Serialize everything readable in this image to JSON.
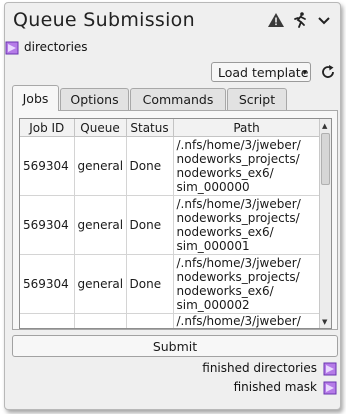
{
  "node": {
    "title": "Queue Submission",
    "header_icons": [
      "warning-icon",
      "running-person-icon",
      "chevron-down-icon"
    ],
    "input_port_label": "directories",
    "load_template_label": "Load template",
    "tabs": [
      {
        "label": "Jobs",
        "active": true
      },
      {
        "label": "Options",
        "active": false
      },
      {
        "label": "Commands",
        "active": false
      },
      {
        "label": "Script",
        "active": false
      }
    ],
    "table": {
      "columns": [
        "Job ID",
        "Queue",
        "Status",
        "Path"
      ],
      "rows": [
        {
          "job_id": "569304",
          "queue": "general",
          "status": "Done",
          "path": "/.nfs/home/3/jweber/ nodeworks_projects/ nodeworks_ex6/ sim_000000"
        },
        {
          "job_id": "569304",
          "queue": "general",
          "status": "Done",
          "path": "/.nfs/home/3/jweber/ nodeworks_projects/ nodeworks_ex6/ sim_000001"
        },
        {
          "job_id": "569304",
          "queue": "general",
          "status": "Done",
          "path": "/.nfs/home/3/jweber/ nodeworks_projects/ nodeworks_ex6/ sim_000002"
        },
        {
          "job_id": "",
          "queue": "",
          "status": "",
          "path": "/.nfs/home/3/jweber/"
        }
      ]
    },
    "submit_label": "Submit",
    "output_ports": [
      "finished directories",
      "finished mask"
    ],
    "colors": {
      "port": "#b57be8",
      "port_border": "#6a34b0",
      "panel": "#efefef"
    }
  }
}
